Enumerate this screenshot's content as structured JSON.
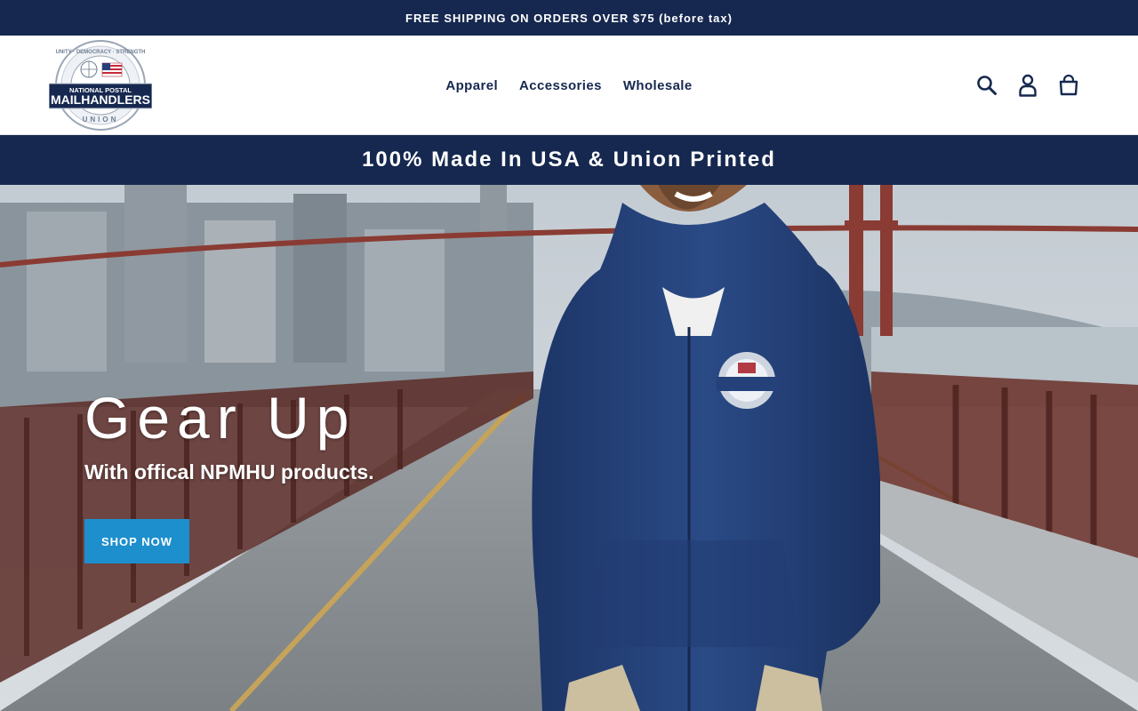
{
  "announcement": {
    "text": "FREE SHIPPING ON ORDERS OVER $75 (before tax)"
  },
  "header": {
    "logo": {
      "top_text": "UNITY · DEMOCRACY · STRENGTH",
      "band_line1": "NATIONAL POSTAL",
      "band_line2": "MAILHANDLERS",
      "bottom_text": "UNION"
    },
    "nav": [
      {
        "label": "Apparel"
      },
      {
        "label": "Accessories"
      },
      {
        "label": "Wholesale"
      }
    ],
    "icons": [
      "search-icon",
      "account-icon",
      "cart-icon"
    ]
  },
  "tagline": {
    "text": "100% Made In USA & Union Printed"
  },
  "hero": {
    "title": "Gear Up",
    "subtitle": "With offical NPMHU products.",
    "button_label": "SHOP NOW"
  },
  "colors": {
    "navy": "#16284f",
    "button": "#1d8fcd",
    "white": "#ffffff"
  }
}
